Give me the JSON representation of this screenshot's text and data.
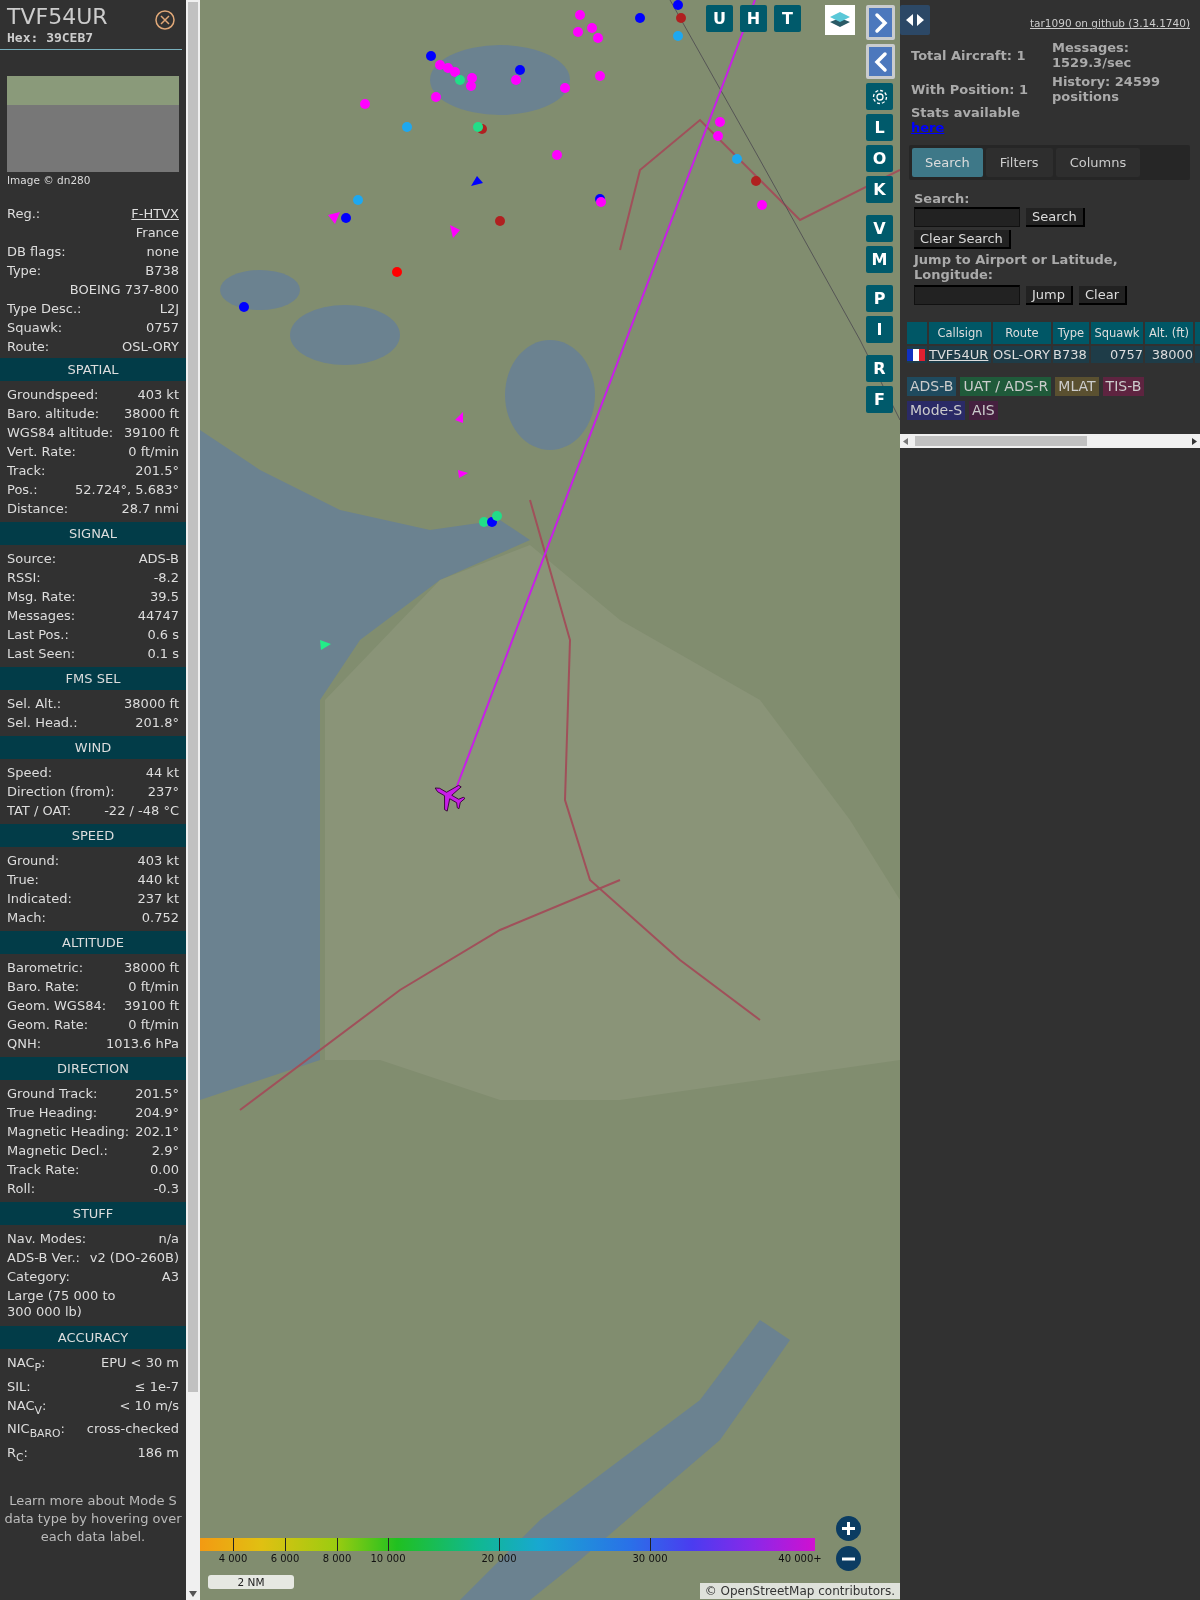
{
  "aircraft_panel": {
    "callsign": "TVF54UR",
    "hex": "Hex: 39CEB7",
    "photo_credit": "Image © dn280",
    "details": [
      {
        "kind": "link",
        "label": "Reg.:",
        "value": "F-HTVX"
      },
      {
        "kind": "value",
        "value": "France"
      },
      {
        "kind": "pair",
        "label": "DB flags:",
        "value": "none"
      },
      {
        "kind": "pair",
        "label": "Type:",
        "value": "B738"
      },
      {
        "kind": "value",
        "value": "BOEING 737-800"
      },
      {
        "kind": "pair",
        "label": "Type Desc.:",
        "value": "L2J"
      },
      {
        "kind": "pair",
        "label": "Squawk:",
        "value": "0757"
      },
      {
        "kind": "pair",
        "label": "Route:",
        "value": "OSL-ORY"
      }
    ],
    "sections": [
      {
        "title": "SPATIAL",
        "rows": [
          {
            "kind": "pair",
            "label": "Groundspeed:",
            "value": "403 kt"
          },
          {
            "kind": "pair",
            "label": "Baro. altitude:",
            "value": "38000 ft"
          },
          {
            "kind": "pair",
            "label": "WGS84 altitude:",
            "value": "39100 ft"
          },
          {
            "kind": "pair",
            "label": "Vert. Rate:",
            "value": "0 ft/min"
          },
          {
            "kind": "pair",
            "label": "Track:",
            "value": "201.5°"
          },
          {
            "kind": "pair",
            "label": "Pos.:",
            "value": "52.724°, 5.683°"
          },
          {
            "kind": "pair",
            "label": "Distance:",
            "value": "28.7 nmi"
          }
        ]
      },
      {
        "title": "SIGNAL",
        "rows": [
          {
            "kind": "pair",
            "label": "Source:",
            "value": "ADS-B"
          },
          {
            "kind": "pair",
            "label": "RSSI:",
            "value": "-8.2"
          },
          {
            "kind": "pair",
            "label": "Msg. Rate:",
            "value": "39.5"
          },
          {
            "kind": "pair",
            "label": "Messages:",
            "value": "44747"
          },
          {
            "kind": "pair",
            "label": "Last Pos.:",
            "value": "0.6 s"
          },
          {
            "kind": "pair",
            "label": "Last Seen:",
            "value": "0.1 s"
          }
        ]
      },
      {
        "title": "FMS SEL",
        "rows": [
          {
            "kind": "pair",
            "label": "Sel. Alt.:",
            "value": "38000 ft"
          },
          {
            "kind": "pair",
            "label": "Sel. Head.:",
            "value": "201.8°"
          }
        ]
      },
      {
        "title": "WIND",
        "rows": [
          {
            "kind": "pair",
            "label": "Speed:",
            "value": "44 kt"
          },
          {
            "kind": "pair",
            "label": "Direction (from):",
            "value": "237°"
          },
          {
            "kind": "pair",
            "label": "TAT / OAT:",
            "value": "-22 / -48 °C"
          }
        ]
      },
      {
        "title": "SPEED",
        "rows": [
          {
            "kind": "pair",
            "label": "Ground:",
            "value": "403 kt"
          },
          {
            "kind": "pair",
            "label": "True:",
            "value": "440 kt"
          },
          {
            "kind": "pair",
            "label": "Indicated:",
            "value": "237 kt"
          },
          {
            "kind": "pair",
            "label": "Mach:",
            "value": "0.752"
          }
        ]
      },
      {
        "title": "ALTITUDE",
        "rows": [
          {
            "kind": "pair",
            "label": "Barometric:",
            "value": "38000 ft"
          },
          {
            "kind": "pair",
            "label": "Baro. Rate:",
            "value": "0 ft/min"
          },
          {
            "kind": "pair",
            "label": "Geom. WGS84:",
            "value": "39100 ft"
          },
          {
            "kind": "pair",
            "label": "Geom. Rate:",
            "value": "0 ft/min"
          },
          {
            "kind": "pair",
            "label": "QNH:",
            "value": "1013.6 hPa"
          }
        ]
      },
      {
        "title": "DIRECTION",
        "rows": [
          {
            "kind": "pair",
            "label": "Ground Track:",
            "value": "201.5°"
          },
          {
            "kind": "pair",
            "label": "True Heading:",
            "value": "204.9°"
          },
          {
            "kind": "pair",
            "label": "Magnetic Heading:",
            "value": "202.1°"
          },
          {
            "kind": "pair",
            "label": "Magnetic Decl.:",
            "value": "2.9°"
          },
          {
            "kind": "pair",
            "label": "Track Rate:",
            "value": "0.00"
          },
          {
            "kind": "pair",
            "label": "Roll:",
            "value": "-0.3"
          }
        ]
      },
      {
        "title": "STUFF",
        "rows": [
          {
            "kind": "pair",
            "label": "Nav. Modes:",
            "value": "n/a"
          },
          {
            "kind": "pair",
            "label": "ADS-B Ver.:",
            "value": "v2 (DO-260B)"
          },
          {
            "kind": "pair",
            "label": "Category:",
            "value": "A3"
          },
          {
            "kind": "note",
            "value": "Large (75 000 to 300 000 lb)"
          }
        ]
      },
      {
        "title": "ACCURACY",
        "rows": [
          {
            "kind": "pair",
            "label": "NAC$_{P}$:",
            "value": "EPU < 30 m"
          },
          {
            "kind": "pair",
            "label": "SIL:",
            "value": "≤ 1e-7"
          },
          {
            "kind": "pair",
            "label": "NAC$_{V}$:",
            "value": "< 10 m/s"
          },
          {
            "kind": "pair",
            "label": "NIC$_{BARO}$:",
            "value": "cross-checked"
          },
          {
            "kind": "pair",
            "label": "R$_{C}$:",
            "value": "186 m"
          }
        ]
      }
    ],
    "footer": "Learn more about Mode S data type by hovering over each data label."
  },
  "map": {
    "top_buttons": [
      "U",
      "H",
      "T"
    ],
    "side_button_groups": [
      [
        "L",
        "O",
        "K"
      ],
      [
        "V",
        "M"
      ],
      [
        "P",
        "I"
      ],
      [
        "R",
        "F"
      ]
    ],
    "altitude_legend": [
      "4 000",
      "6 000",
      "8 000",
      "10 000",
      "20 000",
      "30 000",
      "40 000+"
    ],
    "scale": "2 NM",
    "attribution": "© OpenStreetMap contributors."
  },
  "right_panel": {
    "github_link": "tar1090 on github (3.14.1740)",
    "stats": [
      "Total Aircraft: 1",
      "With Position: 1",
      "Messages: 1529.3/sec",
      "History: 24599 positions"
    ],
    "stats_note": "Stats available",
    "stats_link": "here",
    "tabs": [
      {
        "label": "Search",
        "selected": true
      },
      {
        "label": "Filters",
        "selected": false
      },
      {
        "label": "Columns",
        "selected": false
      }
    ],
    "search": {
      "label": "Search:",
      "button": "Search",
      "clear_button": "Clear Search"
    },
    "jump": {
      "label": "Jump to Airport or Latitude, Longitude:",
      "button": "Jump",
      "clear_button": "Clear"
    },
    "table": {
      "columns": [
        "Callsign",
        "Route",
        "Type",
        "Squawk",
        "Alt. (ft)"
      ],
      "rows": [
        {
          "cells": [
            "TVF54UR",
            "OSL-ORY",
            "B738",
            "0757",
            "38000"
          ]
        }
      ]
    },
    "source_badges": [
      {
        "label": "ADS-B",
        "color": "#1f4a5e"
      },
      {
        "label": "UAT / ADS-R",
        "color": "#1f5a3a"
      },
      {
        "label": "MLAT",
        "color": "#5a5030"
      },
      {
        "label": "TIS-B",
        "color": "#5e2440"
      },
      {
        "label": "Mode-S",
        "color": "#2a2a66"
      },
      {
        "label": "AIS",
        "color": "#45203f"
      }
    ]
  }
}
